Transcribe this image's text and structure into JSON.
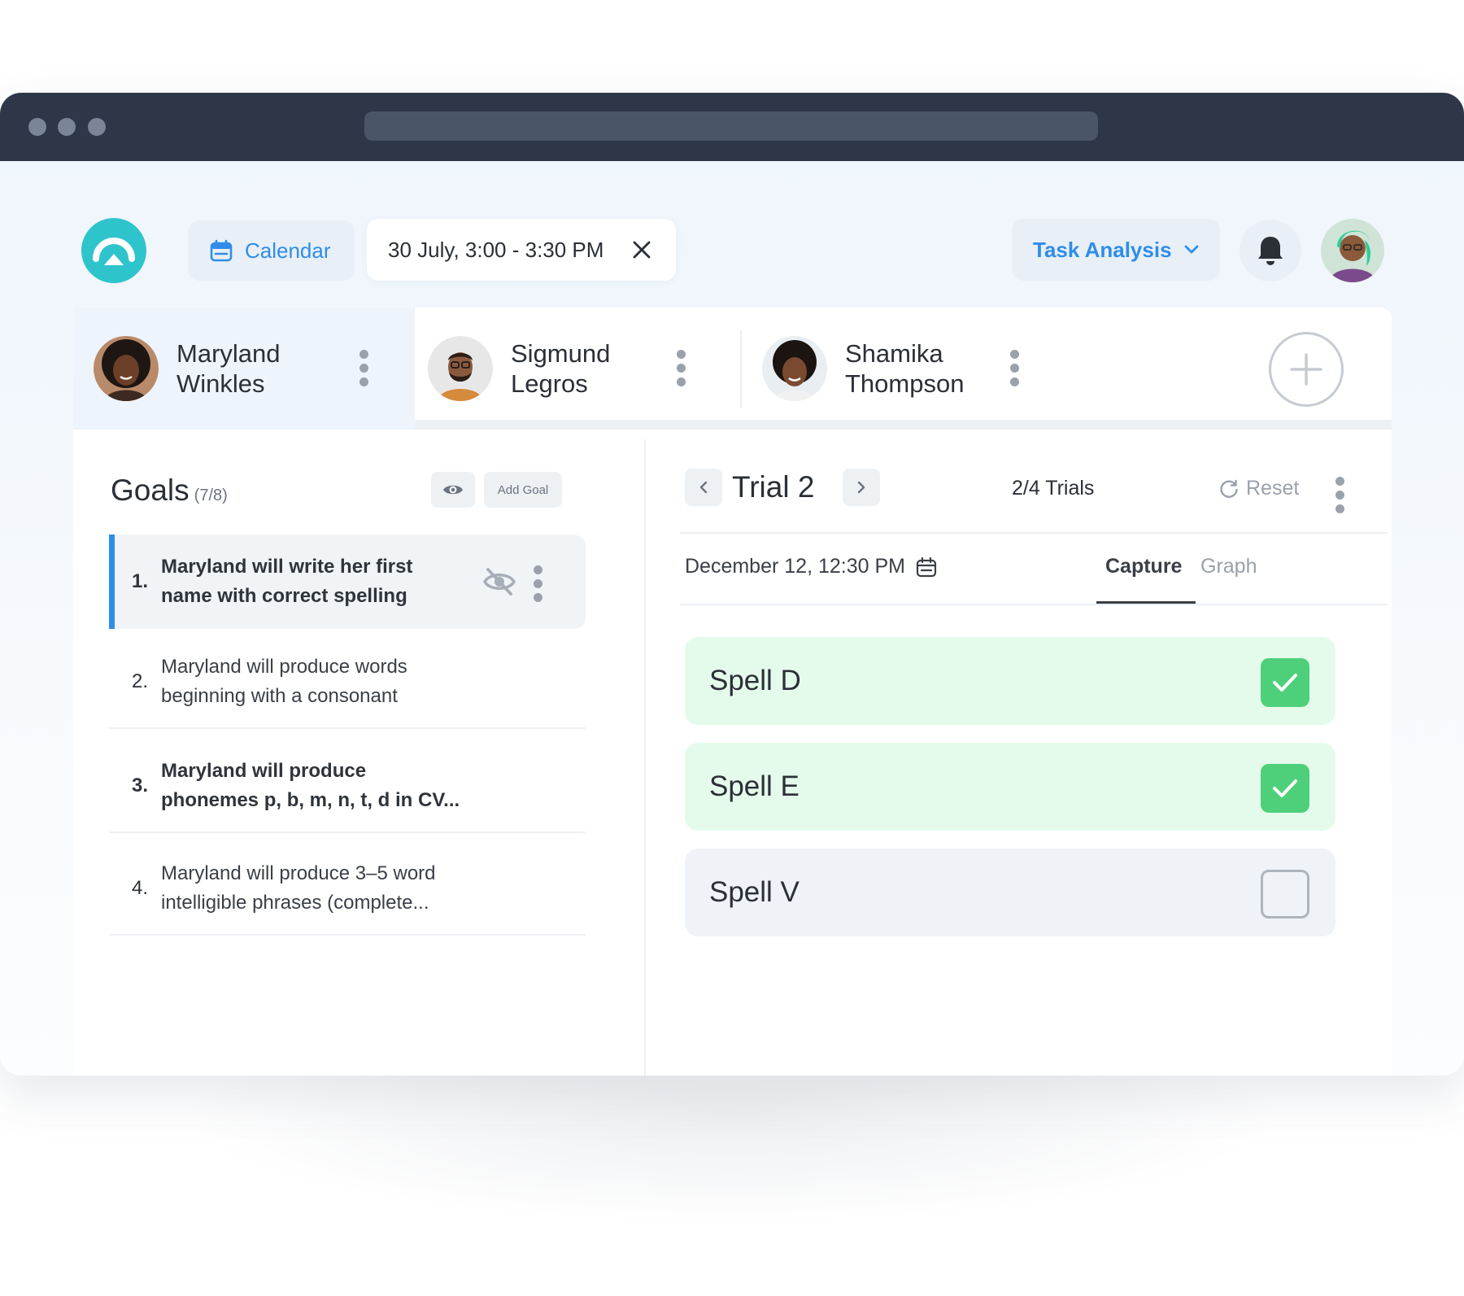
{
  "colors": {
    "accent": "#2f8dea",
    "brand": "#2ec4cc",
    "success": "#4ed07a",
    "titlebar": "#2d3748"
  },
  "header": {
    "calendar_label": "Calendar",
    "session_time": "30 July, 3:00 - 3:30 PM",
    "mode_label": "Task Analysis"
  },
  "students": [
    {
      "first": "Maryland",
      "last": "Winkles",
      "selected": true
    },
    {
      "first": "Sigmund",
      "last": "Legros",
      "selected": false
    },
    {
      "first": "Shamika",
      "last": "Thompson",
      "selected": false
    }
  ],
  "goals": {
    "title": "Goals",
    "count": "(7/8)",
    "add_label": "Add Goal",
    "items": [
      {
        "num": "1.",
        "line1": "Maryland will write her first",
        "line2": "name with correct spelling",
        "active": true,
        "hidden": true
      },
      {
        "num": "2.",
        "line1": "Maryland will produce words",
        "line2": "beginning with a consonant",
        "active": false
      },
      {
        "num": "3.",
        "line1": "Maryland will produce",
        "line2": "phonemes p, b, m, n, t, d in CV...",
        "active": false,
        "bold": true
      },
      {
        "num": "4.",
        "line1": "Maryland will produce 3–5 word",
        "line2": "intelligible phrases (complete...",
        "active": false
      }
    ]
  },
  "trial": {
    "title": "Trial 2",
    "count": "2/4 Trials",
    "reset_label": "Reset",
    "date": "December 12, 12:30 PM",
    "tabs": {
      "capture": "Capture",
      "graph": "Graph",
      "active": "capture"
    },
    "steps": [
      {
        "label": "Spell D",
        "checked": true
      },
      {
        "label": "Spell E",
        "checked": true
      },
      {
        "label": "Spell V",
        "checked": false
      }
    ]
  },
  "icons": [
    "app-logo-icon",
    "calendar-icon",
    "close-icon",
    "chevron-down-icon",
    "bell-icon",
    "eye-icon",
    "eye-off-icon",
    "chevron-left-icon",
    "chevron-right-icon",
    "refresh-icon",
    "check-icon",
    "plus-icon",
    "kebab-icon"
  ]
}
